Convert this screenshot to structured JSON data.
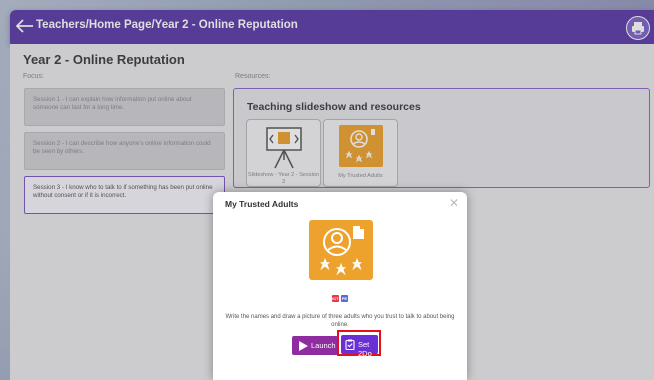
{
  "header": {
    "breadcrumb": "Teachers/Home Page/Year 2 - Online Reputation",
    "back_icon": "back-arrow-icon",
    "print_icon": "print-icon",
    "bar_color": "#5a3aa7"
  },
  "main": {
    "title": "Year 2 - Online Reputation",
    "focus_label": "Focus:",
    "resources_label": "Resources:",
    "sessions": [
      {
        "text": "Session 1 - I can explain how information put online about someone can last for a long time."
      },
      {
        "text": "Session 2 - I can describe how anyone's online information could be seen by others."
      },
      {
        "text": "Session 3 - I know who to talk to if something has been put online without consent or if it is incorrect."
      }
    ],
    "resources": {
      "title": "Teaching slideshow and resources",
      "tiles": [
        {
          "label": "Slideshow - Year 2 - Session 3",
          "icon": "slideshow-icon"
        },
        {
          "label": "My Trusted Adults",
          "icon": "trusted-adults-icon"
        }
      ]
    }
  },
  "modal": {
    "title": "My Trusted Adults",
    "close_icon": "close-icon",
    "icon": "trusted-adults-icon",
    "badges": [
      "ICT",
      "PE"
    ],
    "description": "Write the names and draw a picture of three adults who you trust to talk to about being online.",
    "launch_label": "Launch",
    "set2do_label": "Set 2Do",
    "accent_color": "#eda22d",
    "launch_color": "#8e2ca0",
    "set2do_color": "#6a2fd5",
    "highlight_color": "#e60f19"
  }
}
